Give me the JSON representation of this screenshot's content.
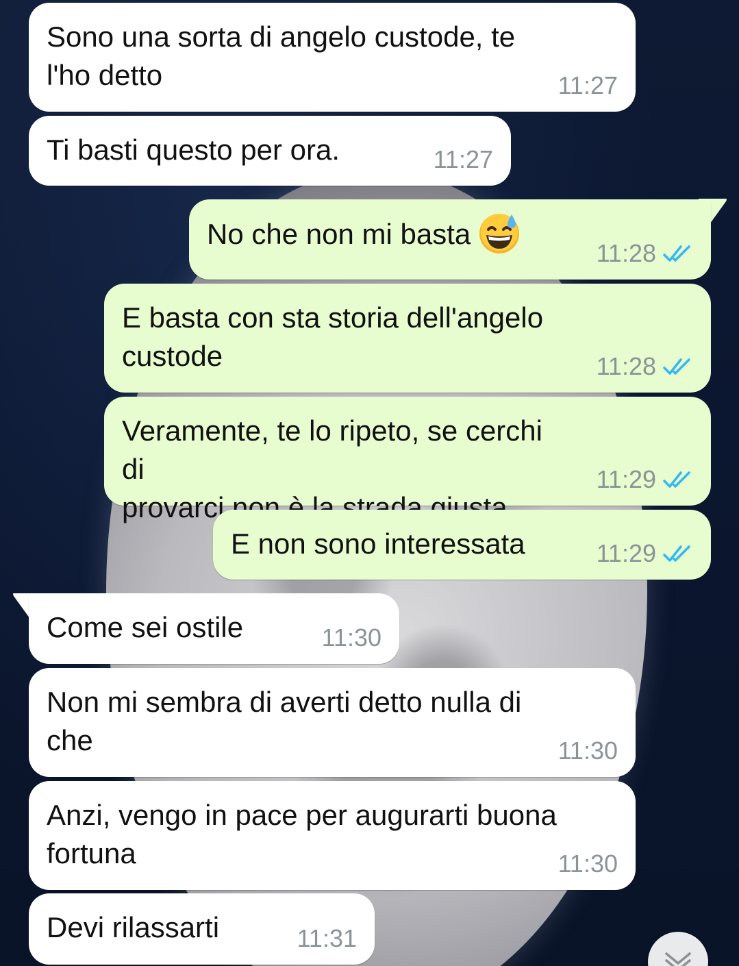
{
  "messages": [
    {
      "direction": "in",
      "text": "Sono una sorta di angelo custode, te\nl'ho detto",
      "time": "11:27"
    },
    {
      "direction": "in",
      "text": "Ti basti questo per ora.",
      "time": "11:27"
    },
    {
      "direction": "out",
      "text": "No che non mi basta",
      "emoji": "grinning-face-with-sweat",
      "time": "11:28",
      "status": "read"
    },
    {
      "direction": "out",
      "text": "E basta con sta storia dell'angelo\ncustode",
      "time": "11:28",
      "status": "read"
    },
    {
      "direction": "out",
      "text": "Veramente, te lo ripeto, se cerchi di\nprovarci non è la strada giusta",
      "time": "11:29",
      "status": "read"
    },
    {
      "direction": "out",
      "text": "E non sono interessata",
      "time": "11:29",
      "status": "read"
    },
    {
      "direction": "in",
      "text": "Come sei ostile",
      "time": "11:30"
    },
    {
      "direction": "in",
      "text": "Non mi sembra di averti detto nulla di\nche",
      "time": "11:30"
    },
    {
      "direction": "in",
      "text": "Anzi, vengo in pace per augurarti buona\nfortuna",
      "time": "11:30"
    },
    {
      "direction": "in",
      "text": "Devi rilassarti",
      "time": "11:31"
    }
  ],
  "colors": {
    "incoming_bubble": "#ffffff",
    "outgoing_bubble": "#e7fccf",
    "timestamp": "#8b9396",
    "read_ticks": "#34b7f1"
  },
  "icons": {
    "read_receipt": "double-check-icon",
    "scroll_down": "chevron-down-icon"
  }
}
